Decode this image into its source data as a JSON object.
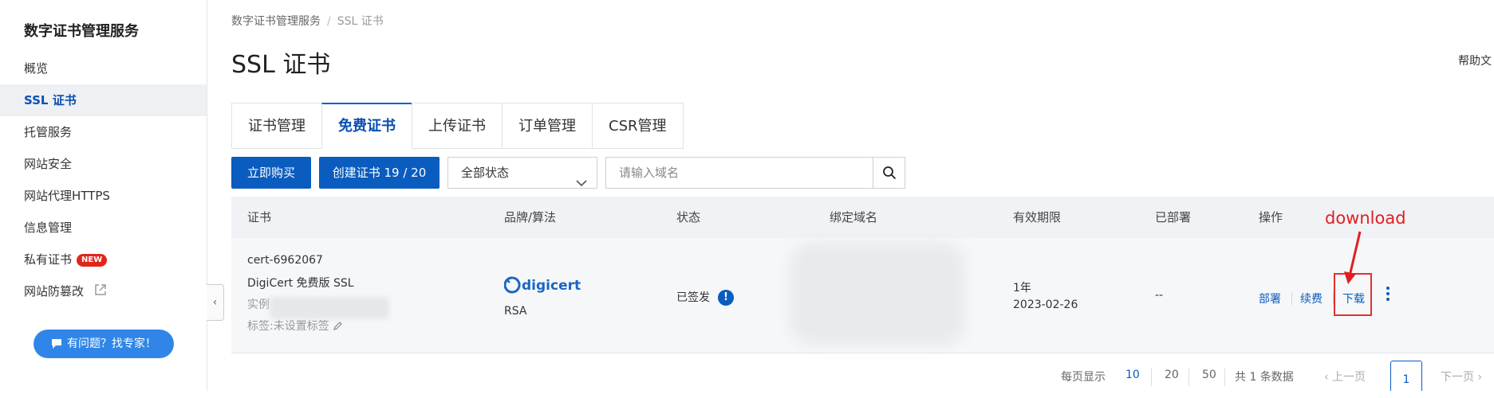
{
  "sidebar": {
    "title": "数字证书管理服务",
    "items": [
      {
        "label": "概览"
      },
      {
        "label": "SSL 证书",
        "active": true
      },
      {
        "label": "托管服务"
      },
      {
        "label": "网站安全"
      },
      {
        "label": "网站代理HTTPS"
      },
      {
        "label": "信息管理"
      },
      {
        "label": "私有证书",
        "badge": "NEW"
      },
      {
        "label": "网站防篡改"
      }
    ],
    "expert_button": "有问题？找专家！"
  },
  "breadcrumb": {
    "root": "数字证书管理服务",
    "separator": "/",
    "current": "SSL 证书"
  },
  "page_title": "SSL 证书",
  "help_link": "帮助文",
  "tabs": [
    {
      "label": "证书管理"
    },
    {
      "label": "免费证书",
      "active": true
    },
    {
      "label": "上传证书"
    },
    {
      "label": "订单管理"
    },
    {
      "label": "CSR管理"
    }
  ],
  "toolbar": {
    "buy_label": "立即购买",
    "create_label": "创建证书 19 / 20",
    "status_select": "全部状态",
    "search_placeholder": "请输入域名"
  },
  "table": {
    "headers": [
      "证书",
      "品牌/算法",
      "状态",
      "绑定域名",
      "有效期限",
      "已部署",
      "操作"
    ],
    "rows": [
      {
        "cert_id": "cert-6962067",
        "cert_name": "DigiCert 免费版 SSL",
        "instance_label": "实例",
        "tag_label": "标签:未设置标签",
        "brand": "digicert",
        "algorithm": "RSA",
        "status": "已签发",
        "validity_period": "1年",
        "validity_date": "2023-02-26",
        "deployed": "--",
        "actions": [
          "部署",
          "续费",
          "下载"
        ]
      }
    ]
  },
  "annotation": {
    "text": "download",
    "color": "#e02020"
  },
  "pagination": {
    "page_size_label": "每页显示",
    "page_sizes": [
      "10",
      "20",
      "50"
    ],
    "selected_page_size": "10",
    "total": "共 1 条数据",
    "prev": "上一页",
    "current_page": "1",
    "next": "下一页"
  },
  "colors": {
    "primary": "#0a5cbf",
    "active_bg": "#eef0f4",
    "badge": "#e0261a",
    "expert_button": "#2f86e8"
  }
}
